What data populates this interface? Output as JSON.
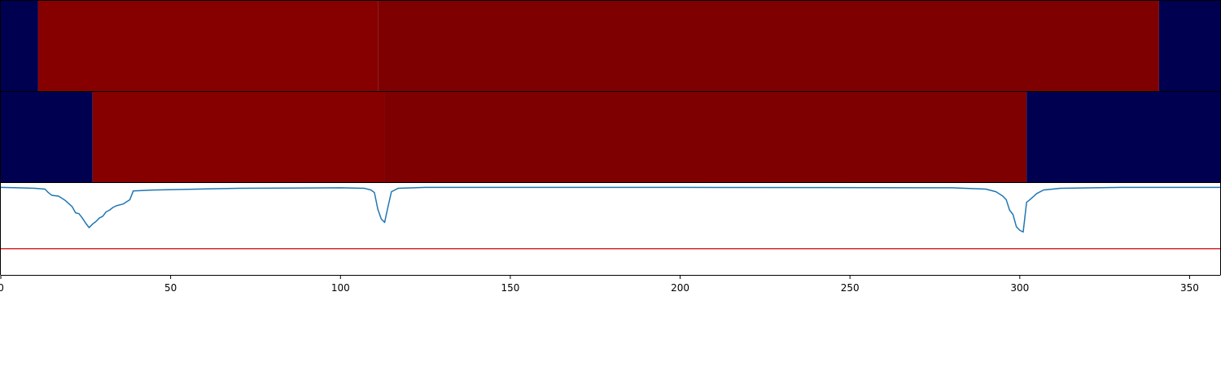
{
  "colors": {
    "background": "#ffffff",
    "band_off": "#000050",
    "band_on": "#860000",
    "band_on_dark": "#7f0000",
    "line": "#1f77b4",
    "threshold": "#d62728",
    "frame": "#000000"
  },
  "chart_data": {
    "type": "line",
    "xlim": [
      0,
      359
    ],
    "grid": false,
    "legend": "none",
    "xticks": [
      {
        "value": 0,
        "label": "0"
      },
      {
        "value": 50,
        "label": "50"
      },
      {
        "value": 100,
        "label": "100"
      },
      {
        "value": 150,
        "label": "150"
      },
      {
        "value": 200,
        "label": "200"
      },
      {
        "value": 250,
        "label": "250"
      },
      {
        "value": 300,
        "label": "300"
      },
      {
        "value": 350,
        "label": "350"
      }
    ],
    "bands": [
      {
        "segments": [
          {
            "start": 0,
            "end": 11,
            "state": "off"
          },
          {
            "start": 11,
            "end": 111,
            "state": "on"
          },
          {
            "start": 111,
            "end": 341,
            "state": "on_dark"
          },
          {
            "start": 341,
            "end": 359,
            "state": "off"
          }
        ]
      },
      {
        "segments": [
          {
            "start": 0,
            "end": 27,
            "state": "off"
          },
          {
            "start": 27,
            "end": 113,
            "state": "on"
          },
          {
            "start": 113,
            "end": 302,
            "state": "on_dark"
          },
          {
            "start": 302,
            "end": 359,
            "state": "off"
          }
        ]
      }
    ],
    "ylim": [
      -1.0,
      0.05
    ],
    "threshold": -0.7,
    "series": [
      {
        "points": [
          [
            0,
            0
          ],
          [
            5,
            -0.005
          ],
          [
            10,
            -0.01
          ],
          [
            13,
            -0.02
          ],
          [
            14,
            -0.06
          ],
          [
            15,
            -0.09
          ],
          [
            17,
            -0.1
          ],
          [
            19,
            -0.15
          ],
          [
            21,
            -0.22
          ],
          [
            22,
            -0.29
          ],
          [
            23,
            -0.3
          ],
          [
            24,
            -0.35
          ],
          [
            25,
            -0.41
          ],
          [
            26,
            -0.46
          ],
          [
            27,
            -0.42
          ],
          [
            28,
            -0.39
          ],
          [
            29,
            -0.35
          ],
          [
            30,
            -0.33
          ],
          [
            31,
            -0.28
          ],
          [
            32,
            -0.26
          ],
          [
            33,
            -0.23
          ],
          [
            34,
            -0.21
          ],
          [
            36,
            -0.19
          ],
          [
            38,
            -0.14
          ],
          [
            39,
            -0.04
          ],
          [
            45,
            -0.03
          ],
          [
            70,
            -0.01
          ],
          [
            100,
            -0.005
          ],
          [
            107,
            -0.01
          ],
          [
            109,
            -0.03
          ],
          [
            110,
            -0.06
          ],
          [
            111,
            -0.25
          ],
          [
            112,
            -0.36
          ],
          [
            113,
            -0.4
          ],
          [
            114,
            -0.22
          ],
          [
            115,
            -0.05
          ],
          [
            117,
            -0.01
          ],
          [
            125,
            0
          ],
          [
            200,
            0
          ],
          [
            280,
            -0.005
          ],
          [
            290,
            -0.02
          ],
          [
            293,
            -0.05
          ],
          [
            295,
            -0.1
          ],
          [
            296,
            -0.14
          ],
          [
            297,
            -0.26
          ],
          [
            298,
            -0.31
          ],
          [
            299,
            -0.45
          ],
          [
            300,
            -0.49
          ],
          [
            301,
            -0.51
          ],
          [
            302,
            -0.17
          ],
          [
            303,
            -0.14
          ],
          [
            305,
            -0.07
          ],
          [
            307,
            -0.03
          ],
          [
            312,
            -0.01
          ],
          [
            330,
            0
          ],
          [
            359,
            0
          ]
        ]
      }
    ]
  }
}
